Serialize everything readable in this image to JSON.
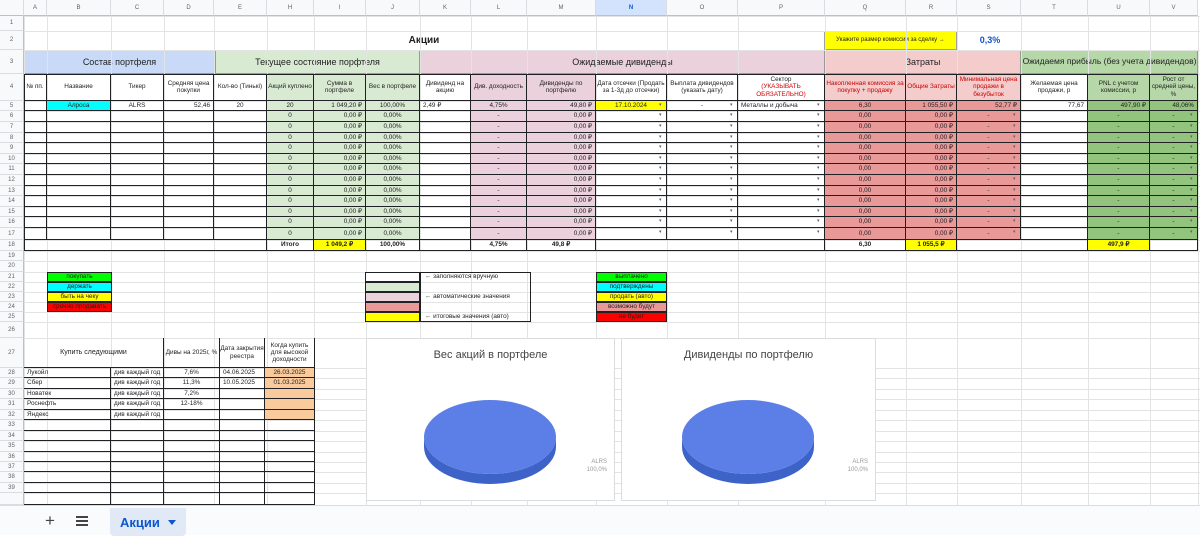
{
  "colors": {
    "blue_header": "#c9daf8",
    "green_header": "#d9ead3",
    "pink_header": "#ead1dc",
    "red_header": "#f4cccc",
    "dark_green_header": "#b6d7a8",
    "computed_cell": "#d9ead3",
    "dividend_cell": "#ead1dc",
    "cost_cell": "#ea9999",
    "profit_cell": "#93c47d",
    "yellow": "#ffff00",
    "cyan": "#00ffff",
    "green": "#00ff00",
    "red": "#ff0000",
    "orange_light": "#f9cb9c",
    "chart_blue": "#5b7fe6",
    "link_blue": "#1155cc"
  },
  "column_letters": [
    "A",
    "B",
    "C",
    "D",
    "E",
    "H",
    "I",
    "J",
    "K",
    "L",
    "M",
    "N",
    "O",
    "P",
    "Q",
    "R",
    "S",
    "T",
    "U",
    "V"
  ],
  "row_numbers": [
    "1",
    "2",
    "3",
    "4",
    "5",
    "6",
    "7",
    "8",
    "9",
    "10",
    "11",
    "12",
    "13",
    "14",
    "15",
    "16",
    "17",
    "18",
    "19",
    "20",
    "21",
    "22",
    "23",
    "24",
    "25",
    "26",
    "27",
    "28",
    "29",
    "30",
    "31",
    "32",
    "33",
    "34",
    "35",
    "36",
    "37",
    "38",
    "39"
  ],
  "title": "Акции",
  "commission": {
    "label": "Укажите размер комиссии за сделку →",
    "value": "0,3%"
  },
  "sections": {
    "portfolio": "Состав портфеля",
    "current": "Текущее состояние порфтеля",
    "dividends": "Ожидаемые дивиденды",
    "costs": "Затраты",
    "profit": "Ожидаемя прибыль (без учета дивидендов)"
  },
  "headers": {
    "num": "№ пп.",
    "name": "Название",
    "ticker": "Тикер",
    "avg_price": "Средняя цена покупки",
    "qty_tinkoff": "Кол-во (Тинькі)",
    "shares_bought": "Акций куплено",
    "sum_portfolio": "Сумма в портфеле",
    "weight": "Вес в портфеле",
    "div_per_share": "Дивиденд на акцию",
    "div_yield": "Див. доходность",
    "div_portfolio": "Дивиденды по портфелю",
    "cutoff_date": "Дата отсечки (Продать за 1-3д до отсечки)",
    "payout": "Выплата дивидендов (указать дату)",
    "sector_label": "Сектор",
    "sector_note": "(УКАЗЫВАТЬ ОБЯЗАТЕЛЬНО)",
    "acc_commission": "Накопленная комиссия за покупку + продажу",
    "total_costs": "Общие Затраты",
    "min_sell_price": "Минимальная цена продажи в безубыток",
    "desired_price": "Желаемая цена продажи, р",
    "pnl": "PNL с учетом комиссии, р",
    "growth": "Рост от средней цены, %"
  },
  "row4": {
    "num": "",
    "name": "Алроса",
    "ticker": "ALRS",
    "avg_price": "52,46",
    "qty_tinkoff": "20",
    "shares_bought": "20",
    "sum_portfolio": "1 049,20 ₽",
    "weight": "100,00%",
    "div_per_share": "2,49 ₽",
    "div_yield": "4,75%",
    "div_portfolio": "49,80 ₽",
    "cutoff_date": "17.10.2024",
    "payout": "-",
    "sector": "Металлы и добыча",
    "acc_commission": "6,30",
    "total_costs": "1 055,50 ₽",
    "min_sell_price": "52,77 ₽",
    "desired_price": "77,67",
    "pnl": "497,90 ₽",
    "growth": "48,06%"
  },
  "empty_row": {
    "shares_bought": "0",
    "sum_portfolio": "0,00 ₽",
    "weight": "0,00%",
    "div_yield": "-",
    "div_portfolio": "0,00 ₽",
    "acc_commission": "0,00",
    "total_costs": "0,00 ₽",
    "min_sell_price": "-",
    "pnl": "-",
    "growth": "-"
  },
  "totals": {
    "label": "Итого",
    "sum_portfolio": "1 049,2 ₽",
    "weight": "100,00%",
    "div_yield": "4,75%",
    "div_portfolio": "49,8 ₽",
    "acc_commission": "6,30",
    "total_costs": "1 055,5 ₽",
    "pnl": "497,9 ₽"
  },
  "legend_status": [
    "покупать",
    "держать",
    "быть на чеку",
    "срочно продавать"
  ],
  "legend_fill": {
    "manual": "← заполняются вручную",
    "auto": "← автоматические значения",
    "totals": "← итоговые значения (авто)"
  },
  "legend_payout": [
    "выплачено",
    "подтверждены",
    "продать (авто)",
    "возможно будут",
    "не будет"
  ],
  "buy_next": {
    "title": "Купить следующими",
    "col_div": "Дивы на 2025г, %",
    "col_date": "Дата закрытия реестра",
    "col_when": "Когда купить для высокой доходности",
    "rows": [
      {
        "name": "Лукойл",
        "freq": "див каждый год",
        "div": "7,6%",
        "date": "04.06.2025",
        "when": "26.03.2025"
      },
      {
        "name": "Сбер",
        "freq": "див каждый год",
        "div": "11,3%",
        "date": "10.05.2025",
        "when": "01.03.2025"
      },
      {
        "name": "Новатек",
        "freq": "див каждый год",
        "div": "7,2%",
        "date": "",
        "when": ""
      },
      {
        "name": "Роснефть",
        "freq": "див каждый год",
        "div": "12-18%",
        "date": "",
        "when": ""
      },
      {
        "name": "Яндекс",
        "freq": "див каждый год",
        "div": "",
        "date": "",
        "when": ""
      }
    ]
  },
  "charts": {
    "weight": {
      "title": "Вес акций в портфеле",
      "slice_label": "ALRS",
      "slice_pct": "100,0%"
    },
    "dividends": {
      "title": "Дивиденды по портфелю",
      "slice_label": "ALRS",
      "slice_pct": "100,0%"
    }
  },
  "chart_data": [
    {
      "type": "pie",
      "title": "Вес акций в портфеле",
      "categories": [
        "ALRS"
      ],
      "values": [
        100.0
      ],
      "legend": "right"
    },
    {
      "type": "pie",
      "title": "Дивиденды по портфелю",
      "categories": [
        "ALRS"
      ],
      "values": [
        100.0
      ],
      "legend": "right"
    }
  ],
  "tabs": {
    "active": "Акции",
    "add_icon": "plus-icon",
    "list_icon": "menu-icon"
  }
}
